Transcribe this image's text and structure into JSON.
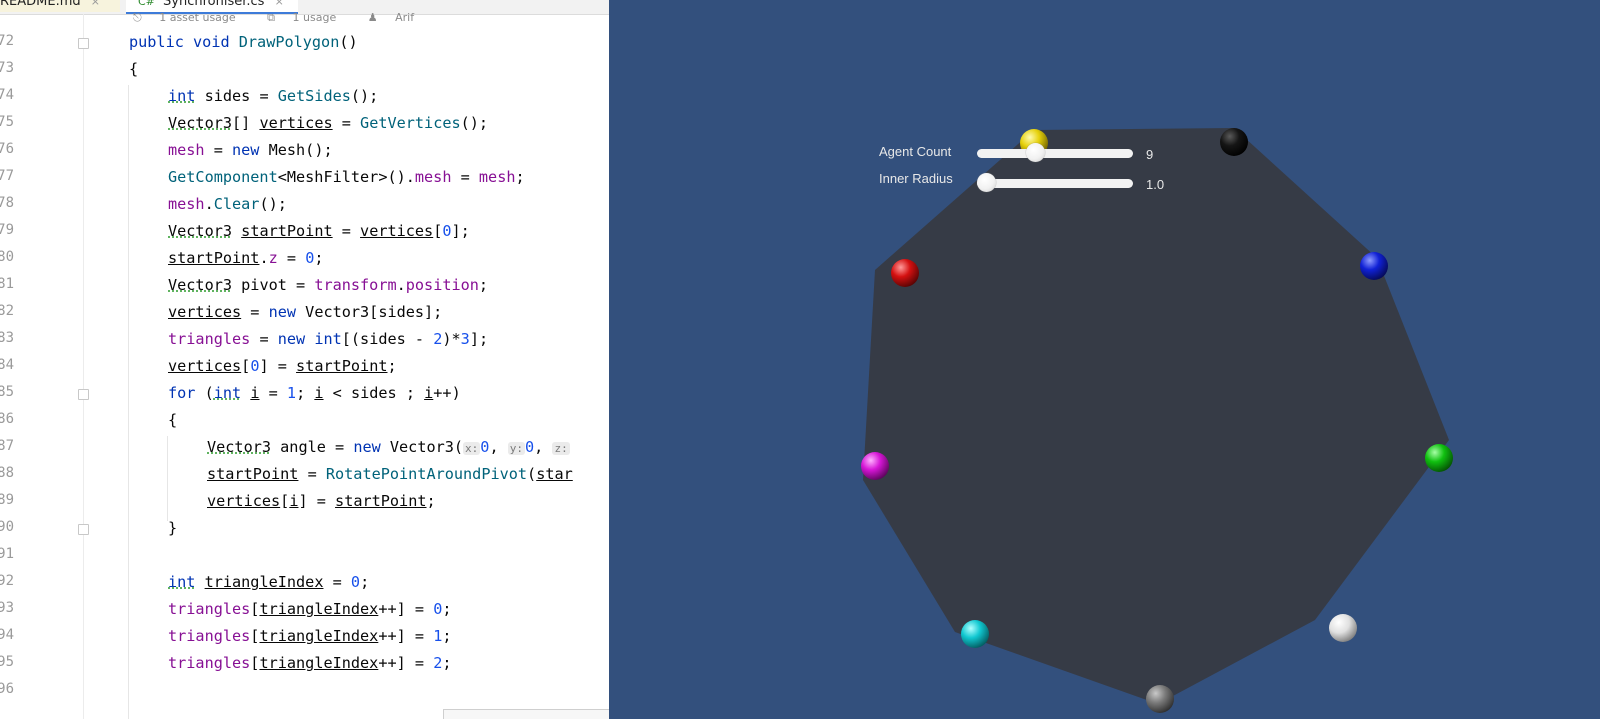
{
  "tabs": [
    {
      "label": "README.md",
      "close": "×"
    },
    {
      "label": "Synchroniser.cs",
      "close": "×"
    }
  ],
  "code_hint": {
    "asset_usage": "1 asset usage",
    "usage": "1 usage",
    "author": "Arif"
  },
  "line_numbers": [
    "72",
    "73",
    "74",
    "75",
    "76",
    "77",
    "78",
    "79",
    "80",
    "81",
    "82",
    "83",
    "84",
    "85",
    "86",
    "87",
    "88",
    "89",
    "90",
    "91",
    "92",
    "93",
    "94",
    "95",
    "96"
  ],
  "inlay_hints": {
    "x": "x:",
    "y": "y:",
    "z": "z:"
  },
  "game_ui": {
    "agent_count": {
      "label": "Agent Count",
      "value": "9",
      "level": 0.36
    },
    "inner_radius": {
      "label": "Inner Radius",
      "value": "1.0",
      "level": 0.0
    }
  },
  "colors": {
    "background": "#33507d",
    "polygon": "#363b46",
    "agents": [
      "yellow",
      "black",
      "blue",
      "green",
      "white",
      "gray",
      "cyan",
      "magenta",
      "red"
    ]
  }
}
